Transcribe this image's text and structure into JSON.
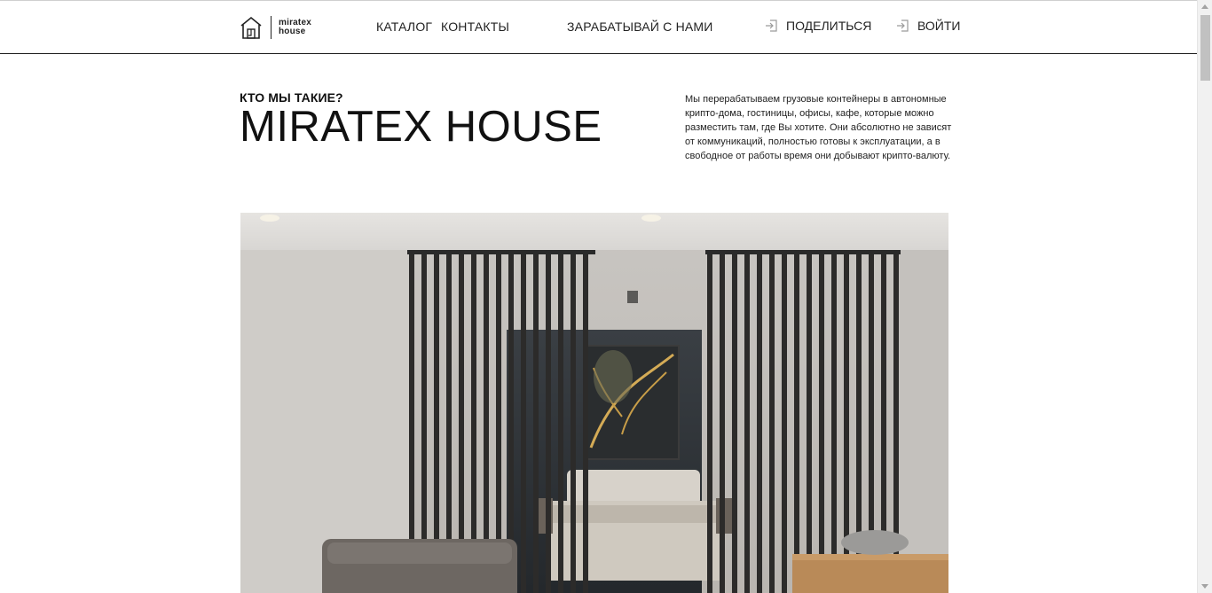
{
  "header": {
    "logo": {
      "line1": "miratex",
      "line2": "house"
    },
    "nav": {
      "catalog": "КАТАЛОГ",
      "contacts": "КОНТАКТЫ",
      "earn": "ЗАРАБАТЫВАЙ С НАМИ",
      "share": "ПОДЕЛИТЬСЯ",
      "login": "ВОЙТИ"
    }
  },
  "intro": {
    "eyebrow": "КТО МЫ ТАКИЕ?",
    "title": "MIRATEX HOUSE",
    "description": "Мы перерабатываем грузовые контейнеры в автономные крипто-дома, гостиницы, офисы, кафе, которые можно разместить там, где Вы хотите. Они абсолютно не зависят от коммуникаций, полностью готовы к эксплуатации, а в свободное от работы время они добывают крипто-валюту."
  },
  "icons": {
    "logo": "house-logo-icon",
    "share": "share-icon",
    "login": "login-icon"
  },
  "colors": {
    "text": "#111111",
    "divider": "#1a1a1a"
  }
}
